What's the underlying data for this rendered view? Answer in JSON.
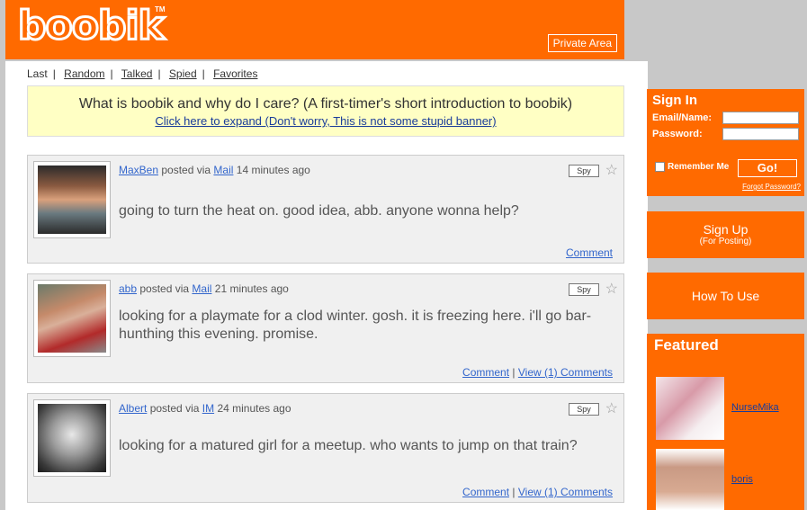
{
  "header": {
    "logo": "boobik",
    "trademark": "TM",
    "private_area": "Private Area"
  },
  "tabs": [
    "Last",
    "Random",
    "Talked",
    "Spied",
    "Favorites"
  ],
  "intro": {
    "question": "What is boobik and why do I care? (A first-timer's short introduction to boobik)",
    "expand": "Click here to expand (Don't worry, This is not some stupid banner)"
  },
  "posts": [
    {
      "user": "MaxBen",
      "via_text": "posted via",
      "via": "Mail",
      "time": "14 minutes ago",
      "message": "going to turn the heat on. good idea, abb. anyone wonna help?",
      "comment": "Comment",
      "view": ""
    },
    {
      "user": "abb",
      "via_text": "posted via",
      "via": "Mail",
      "time": "21 minutes ago",
      "message": "looking for a playmate for a clod winter. gosh. it is freezing here. i'll go bar-hunthing this evening. promise.",
      "comment": "Comment",
      "view": "View (1) Comments"
    },
    {
      "user": "Albert",
      "via_text": "posted via",
      "via": "IM",
      "time": "24 minutes ago",
      "message": "looking for a matured girl for a meetup. who wants to jump on that train?",
      "comment": "Comment",
      "view": "View (1) Comments"
    }
  ],
  "spy_label": "Spy",
  "signin": {
    "title": "Sign In",
    "email_label": "Email/Name:",
    "password_label": "Password:",
    "remember": "Remember Me",
    "go": "Go!",
    "forgot": "Forgot Password?"
  },
  "signup": {
    "title": "Sign Up",
    "sub": "(For Posting)"
  },
  "howto": "How To Use",
  "featured": {
    "title": "Featured",
    "items": [
      "NurseMika",
      "boris"
    ]
  },
  "colors": {
    "brand": "#ff6a00",
    "intro_bg": "#ffffc4",
    "link": "#3366cc"
  }
}
